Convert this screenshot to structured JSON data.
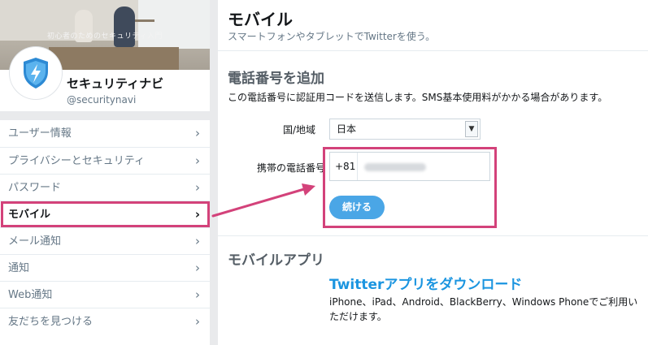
{
  "profile": {
    "banner_caption": "初心者のためのセキュリティ入門",
    "name": "セキュリティナビ",
    "handle": "@securitynavi",
    "avatar_icon": "lightning-shield-icon"
  },
  "sidebar": {
    "items": [
      {
        "label": "ユーザー情報"
      },
      {
        "label": "プライバシーとセキュリティ"
      },
      {
        "label": "パスワード"
      },
      {
        "label": "モバイル"
      },
      {
        "label": "メール通知"
      },
      {
        "label": "通知"
      },
      {
        "label": "Web通知"
      },
      {
        "label": "友だちを見つける"
      }
    ],
    "chevron": "›"
  },
  "main": {
    "title": "モバイル",
    "subtitle": "スマートフォンやタブレットでTwitterを使う。",
    "add_phone": {
      "title": "電話番号を追加",
      "description": "この電話番号に認証用コードを送信します。SMS基本使用料がかかる場合があります。",
      "country_label": "国/地域",
      "country_value": "日本",
      "phone_label": "携帯の電話番号",
      "country_code": "+81",
      "continue_label": "続ける"
    },
    "mobile_apps": {
      "title": "モバイルアプリ",
      "download_link": "Twitterアプリをダウンロード",
      "description": "iPhone、iPad、Android、BlackBerry、Windows Phoneでご利用いただけます。"
    }
  },
  "colors": {
    "highlight": "#d3427a",
    "accent": "#1b95e0",
    "button": "#4aa6e6"
  }
}
